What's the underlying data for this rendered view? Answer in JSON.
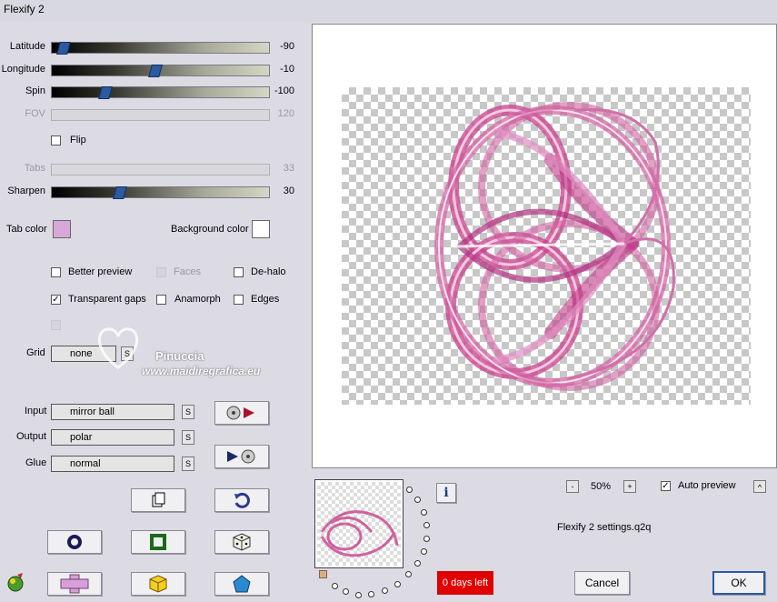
{
  "window": {
    "title": "Flexify 2"
  },
  "sliders": [
    {
      "label": "Latitude",
      "value": "-90",
      "level": 0.03,
      "disabled": false
    },
    {
      "label": "Longitude",
      "value": "-10",
      "level": 0.47,
      "disabled": false
    },
    {
      "label": "Spin",
      "value": "-100",
      "level": 0.23,
      "disabled": false
    },
    {
      "label": "FOV",
      "value": "120",
      "level": null,
      "disabled": true
    },
    {
      "label": "Tabs",
      "value": "33",
      "level": null,
      "disabled": true
    },
    {
      "label": "Sharpen",
      "value": "30",
      "level": 0.3,
      "disabled": false
    }
  ],
  "flip": {
    "label": "Flip",
    "checked": false
  },
  "colors": {
    "tab_label": "Tab color",
    "tab_color": "#d8a8d8",
    "bg_label": "Background color",
    "bg_color": "#ffffff"
  },
  "options": {
    "better_preview": {
      "label": "Better preview",
      "checked": false
    },
    "faces": {
      "label": "Faces",
      "checked": false,
      "disabled": true
    },
    "de_halo": {
      "label": "De-halo",
      "checked": false
    },
    "transparent_gaps": {
      "label": "Transparent gaps",
      "checked": true
    },
    "anamorph": {
      "label": "Anamorph",
      "checked": false
    },
    "edges": {
      "label": "Edges",
      "checked": false
    }
  },
  "grid": {
    "label": "Grid",
    "value": "none"
  },
  "projections": {
    "input_label": "Input",
    "input_value": "mirror ball",
    "output_label": "Output",
    "output_value": "polar",
    "glue_label": "Glue",
    "glue_value": "normal",
    "s_label": "S"
  },
  "watermark": {
    "line1": "Pinuccia",
    "line2": "www.maidiregrafica.eu"
  },
  "info_label": "i",
  "zoom": {
    "minus": "-",
    "value": "50%",
    "plus": "+"
  },
  "auto_preview": {
    "label": "Auto preview",
    "checked": true,
    "arrow": "^"
  },
  "settings_file": "Flexify 2 settings.q2q",
  "trial": "0 days left",
  "buttons": {
    "cancel": "Cancel",
    "ok": "OK"
  },
  "accent_colors": {
    "pink": "#d860a8",
    "trial_red": "#e00000",
    "thumb_blue": "#2c5aa0"
  }
}
